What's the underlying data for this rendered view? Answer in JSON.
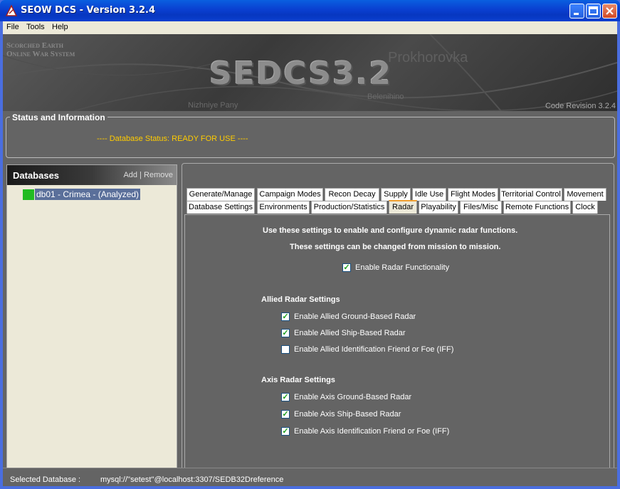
{
  "window": {
    "title": "SEOW DCS - Version 3.2.4"
  },
  "menu": [
    "File",
    "Tools",
    "Help"
  ],
  "banner": {
    "subtitle_line1": "Scorched Earth",
    "subtitle_line2": "Online War System",
    "title": "SEDCS3.2",
    "map_labels": [
      "Prokhorovka",
      "Nizhniye Pany",
      "Belenihino"
    ],
    "revision": "Code Revision 3.2.4"
  },
  "status": {
    "legend": "Status and Information",
    "text": "----  Database Status: READY FOR USE  ----"
  },
  "databases": {
    "title": "Databases",
    "add": "Add",
    "separator": "|",
    "remove": "Remove",
    "items": [
      {
        "label": "db01 - Crimea - (Analyzed)",
        "status_color": "#22bb22"
      }
    ]
  },
  "tabs": {
    "row1": [
      "Generate/Manage",
      "Campaign Modes",
      "Recon Decay",
      "Supply",
      "Idle Use",
      "Flight Modes",
      "Territorial Control",
      "Movement"
    ],
    "row2": [
      "Database Settings",
      "Environments",
      "Production/Statistics",
      "Radar",
      "Playability",
      "Files/Misc",
      "Remote Functions",
      "Clock"
    ],
    "active": "Radar"
  },
  "radar": {
    "intro1": "Use these settings to enable and configure dynamic radar functions.",
    "intro2": "These settings can be changed from mission to mission.",
    "enable_label": "Enable Radar Functionality",
    "enable_checked": true,
    "allied_heading": "Allied Radar Settings",
    "allied": [
      {
        "label": "Enable Allied Ground-Based Radar",
        "checked": true
      },
      {
        "label": "Enable Allied Ship-Based Radar",
        "checked": true
      },
      {
        "label": "Enable Allied Identification Friend or Foe (IFF)",
        "checked": false
      }
    ],
    "axis_heading": "Axis Radar Settings",
    "axis": [
      {
        "label": "Enable Axis Ground-Based Radar",
        "checked": true
      },
      {
        "label": "Enable Axis Ship-Based Radar",
        "checked": true
      },
      {
        "label": "Enable Axis Identification Friend or Foe (IFF)",
        "checked": true
      }
    ]
  },
  "statusbar": {
    "label": "Selected Database :",
    "value": "mysql://''setest''@localhost:3307/SEDB32Dreference"
  }
}
